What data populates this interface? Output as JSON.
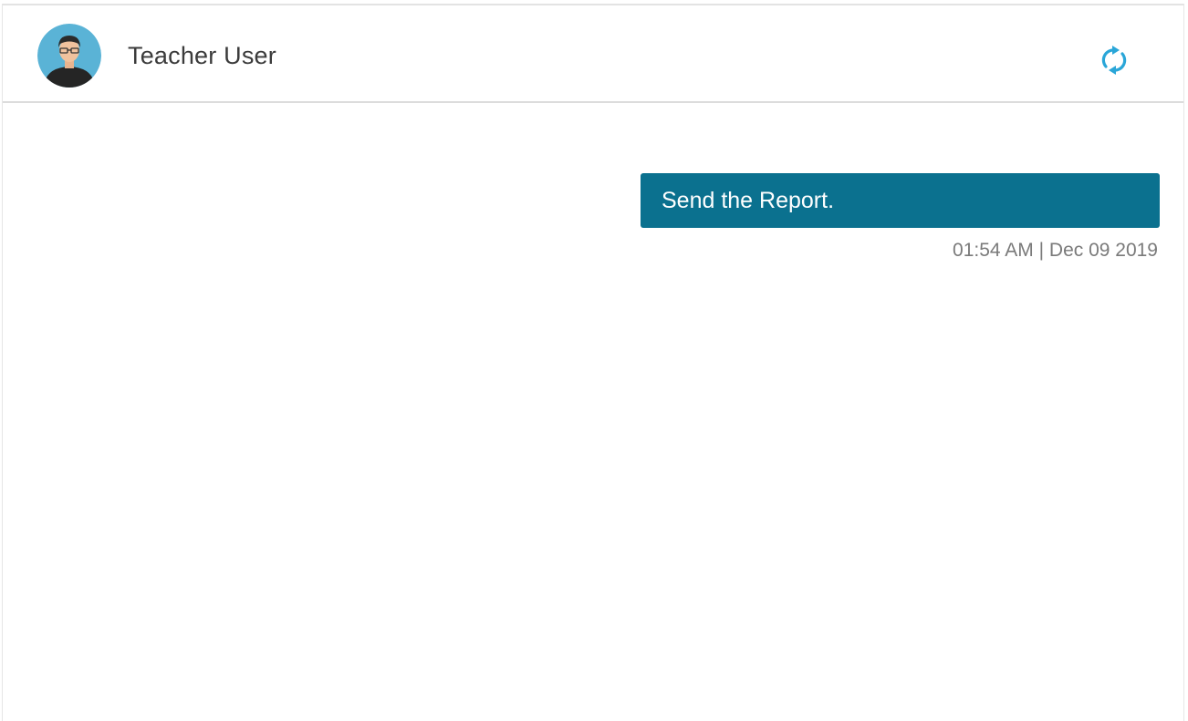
{
  "header": {
    "contact_name": "Teacher User",
    "avatar_icon": "user-avatar-icon",
    "refresh_icon": "refresh-icon"
  },
  "messages": [
    {
      "text": "Send the Report.",
      "timestamp": "01:54 AM | Dec 09 2019",
      "direction": "outgoing"
    }
  ],
  "colors": {
    "accent": "#0b718f",
    "refresh_icon": "#2aa6d8",
    "avatar_bg": "#5ab3d6"
  }
}
